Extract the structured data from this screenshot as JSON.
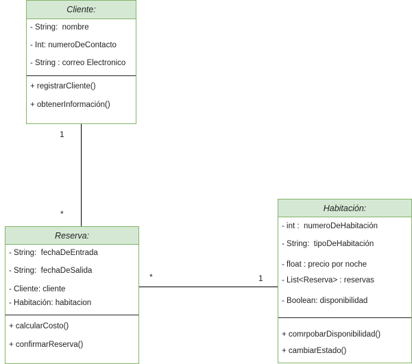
{
  "classes": {
    "cliente": {
      "name": "Cliente:",
      "attributes": [
        "- String:  nombre",
        "- Int: numeroDeContacto",
        "- String : correo Electronico"
      ],
      "operations": [
        "+ registrarCliente()",
        "+ obtenerInformación()"
      ]
    },
    "reserva": {
      "name": "Reserva:",
      "attributes": [
        "- String:  fechaDeEntrada",
        "- String:  fechaDeSalida",
        "- Cliente: cliente",
        "- Habitación: habitacion"
      ],
      "operations": [
        "+ calcularCosto()",
        "+ confirmarReserva()"
      ]
    },
    "habitacion": {
      "name": "Habitación:",
      "attributes": [
        "- int :  numeroDeHabitación",
        "- String:  tipoDeHabitación",
        "- float : precio por noche",
        "- List<Reserva> : reservas",
        "- Boolean: disponibilidad"
      ],
      "operations": [
        "+ comrpobarDisponibilidad()",
        "+ cambiarEstado()"
      ]
    }
  },
  "associations": {
    "cliente_reserva": {
      "cliente_end": "1",
      "reserva_end": "*"
    },
    "reserva_habitacion": {
      "reserva_end": "*",
      "habitacion_end": "1"
    }
  },
  "colors": {
    "class_fill": "#d5e8d4",
    "class_border": "#82b366",
    "line": "#000000"
  }
}
